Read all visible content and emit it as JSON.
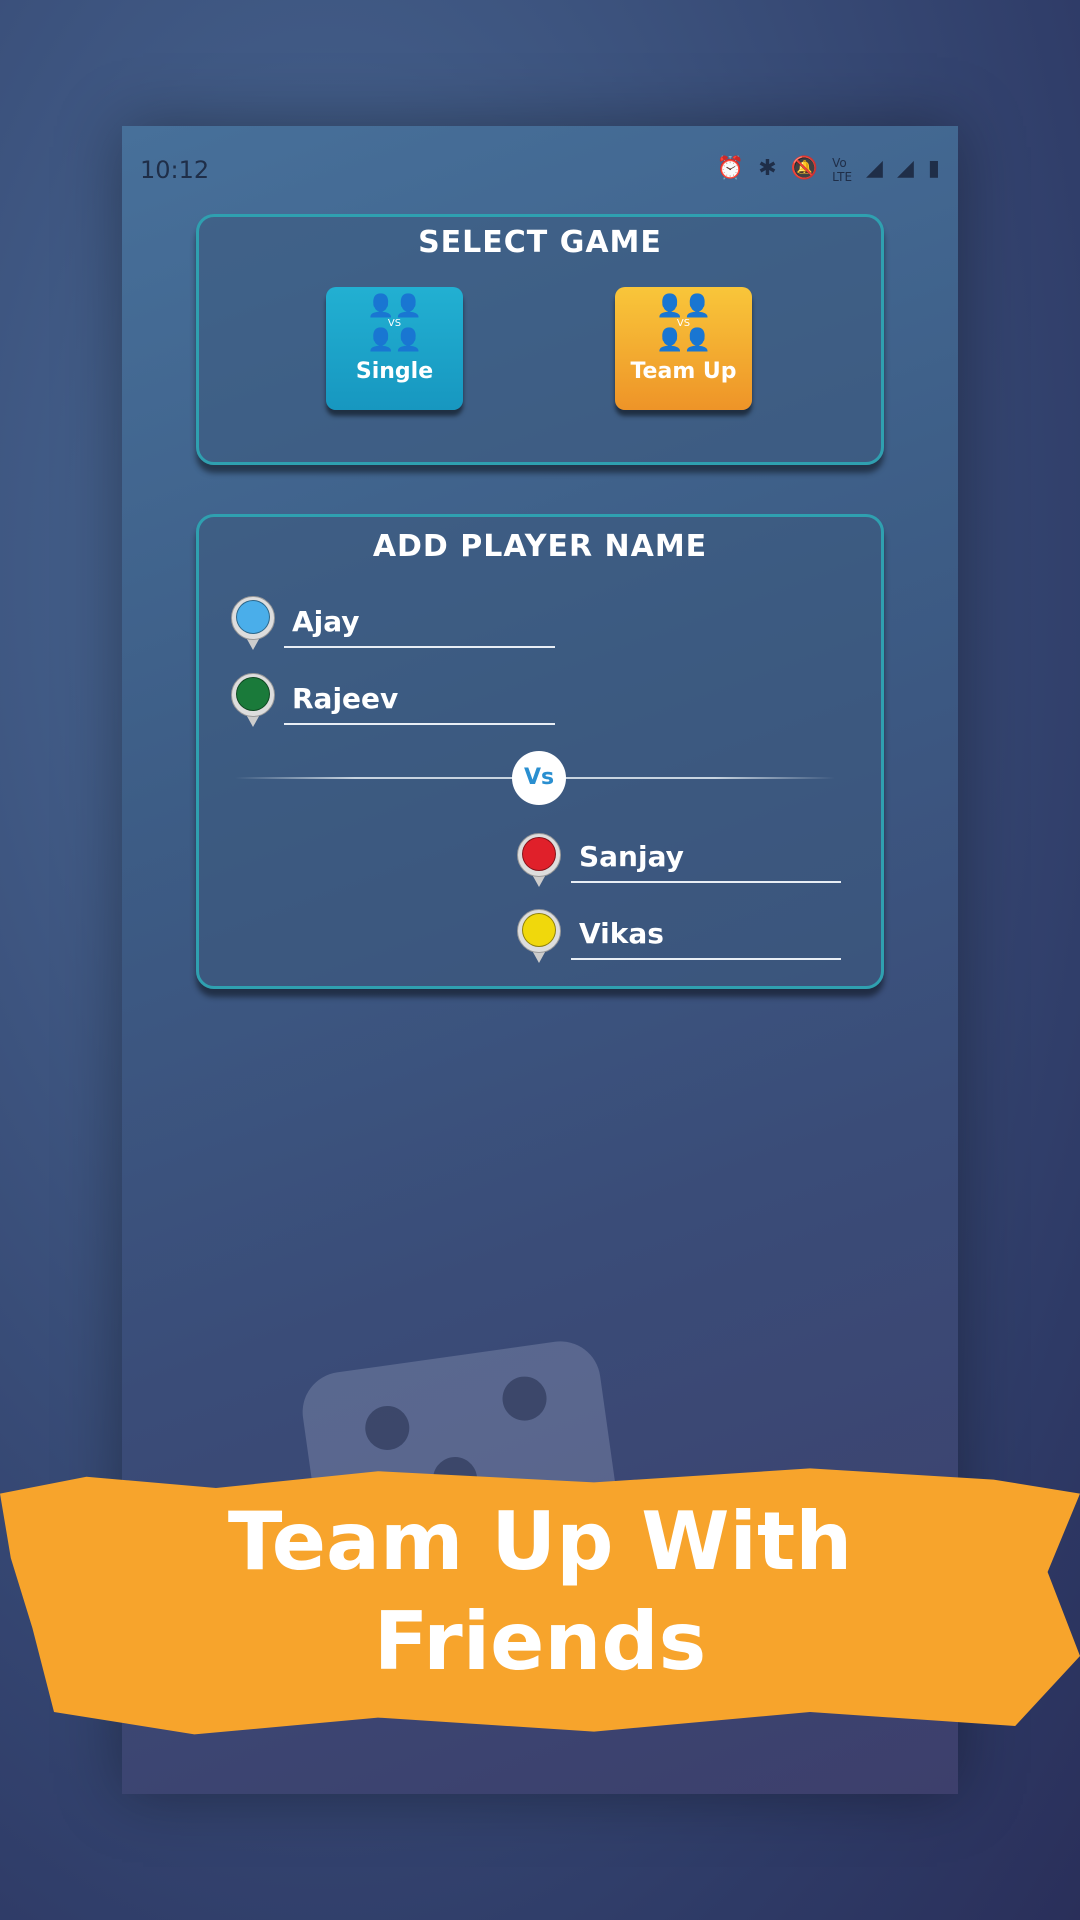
{
  "status_bar": {
    "time": "10:12",
    "icons": [
      "alarm-icon",
      "bluetooth-icon",
      "mute-icon",
      "volte-icon",
      "5g-icon",
      "signal-icon",
      "signal-icon",
      "battery-icon"
    ]
  },
  "select_game": {
    "title": "SELECT GAME",
    "modes": [
      {
        "label": "Single",
        "vs": "VS",
        "color": "#1eaacb",
        "selected": false
      },
      {
        "label": "Team Up",
        "vs": "VS",
        "color": "#f4a630",
        "selected": true
      }
    ]
  },
  "add_player": {
    "title": "ADD PLAYER NAME",
    "vs_label": "Vs",
    "players": [
      {
        "name": "Ajay",
        "color": "#4aaeea"
      },
      {
        "name": "Rajeev",
        "color": "#1a7a3a"
      },
      {
        "name": "Sanjay",
        "color": "#e0202a"
      },
      {
        "name": "Vikas",
        "color": "#f0d80c"
      }
    ]
  },
  "banner": {
    "line1": "Team Up With",
    "line2": "Friends"
  }
}
